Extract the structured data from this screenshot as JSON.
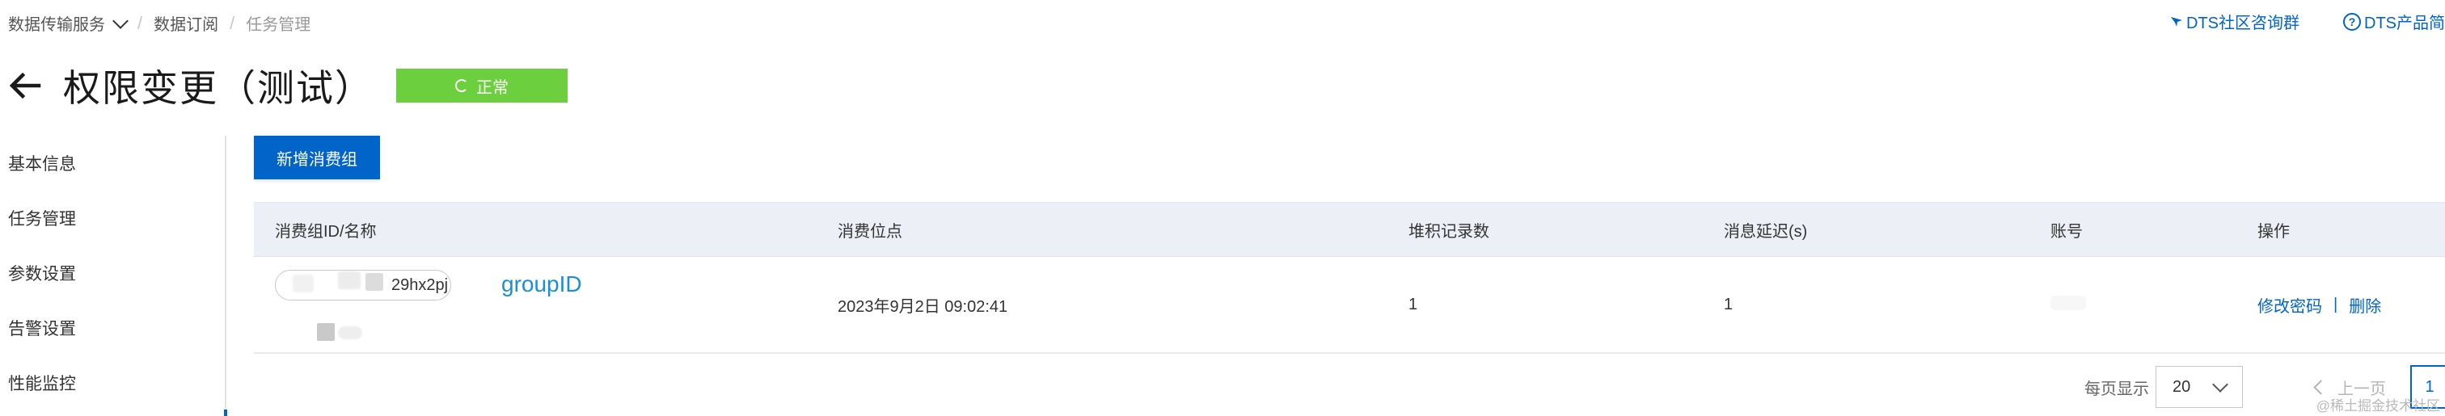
{
  "breadcrumb": {
    "items": [
      "数据传输服务",
      "数据订阅",
      "任务管理"
    ],
    "separator": "/"
  },
  "top_links": {
    "community": "DTS社区咨询群",
    "product": "DTS产品简"
  },
  "header": {
    "title": "权限变更（测试）",
    "status": "正常",
    "status_color": "#6ccf3d"
  },
  "sidebar": {
    "items": [
      {
        "label": "基本信息"
      },
      {
        "label": "任务管理"
      },
      {
        "label": "参数设置"
      },
      {
        "label": "告警设置"
      },
      {
        "label": "性能监控"
      }
    ]
  },
  "toolbar": {
    "add_consumer_group": "新增消费组"
  },
  "table": {
    "columns": [
      "消费组ID/名称",
      "消费位点",
      "堆积记录数",
      "消息延迟(s)",
      "账号",
      "操作"
    ],
    "rows": [
      {
        "group_id_partial": "29hx2pj",
        "annotation": "groupID",
        "consume_point": "2023年9月2日 09:02:41",
        "backlog": "1",
        "delay": "1",
        "account": "",
        "actions": {
          "modify_password": "修改密码",
          "delete": "删除",
          "separator": "|"
        }
      }
    ]
  },
  "pagination": {
    "page_size_label": "每页显示",
    "page_size": "20",
    "prev": "上一页",
    "current_page": "1"
  },
  "watermark": "@稀土掘金技术社区",
  "colors": {
    "primary": "#0064c8",
    "header_bg": "#ecf0f6",
    "annotation": "#1a8fd6"
  },
  "icons": {
    "back": "arrow-left-icon",
    "community": "bird-icon",
    "help": "question-circle-icon",
    "status": "spinner-icon",
    "dropdown": "chevron-down-icon",
    "prev": "chevron-left-icon"
  }
}
